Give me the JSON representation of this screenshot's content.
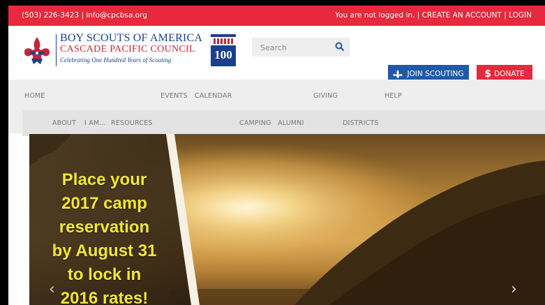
{
  "topbar": {
    "contact": "(503) 226-3423 | info@cpcbsa.org",
    "not_logged_in": "You are not logged in.",
    "separator": "|",
    "create_account": "CREATE AN ACCOUNT",
    "login": "LOGIN"
  },
  "header": {
    "org_name": "BOY SCOUTS OF AMERICA",
    "council_name": "CASCADE PACIFIC COUNCIL",
    "tagline": "Celebrating One Hundred Years of Scouting",
    "badge_text": "100"
  },
  "search": {
    "placeholder": "Search"
  },
  "buttons": {
    "join": "JOIN SCOUTING",
    "donate": "DONATE",
    "donate_symbol": "$"
  },
  "nav": {
    "primary": [
      "HOME",
      "EVENTS",
      "CALENDAR",
      "GIVING",
      "HELP"
    ],
    "secondary": [
      "ABOUT",
      "I AM...",
      "RESOURCES",
      "CAMPING",
      "ALUMNI",
      "DISTRICTS"
    ]
  },
  "hero": {
    "promo_lines": [
      "Place your",
      "2017 camp",
      "reservation",
      "by August 31",
      "to lock in",
      "2016 rates!"
    ],
    "prev_arrow": "‹",
    "next_arrow": "›"
  },
  "colors": {
    "brand_red": "#e8283c",
    "brand_blue": "#1e5aa8",
    "promo_yellow": "#f2e636"
  }
}
